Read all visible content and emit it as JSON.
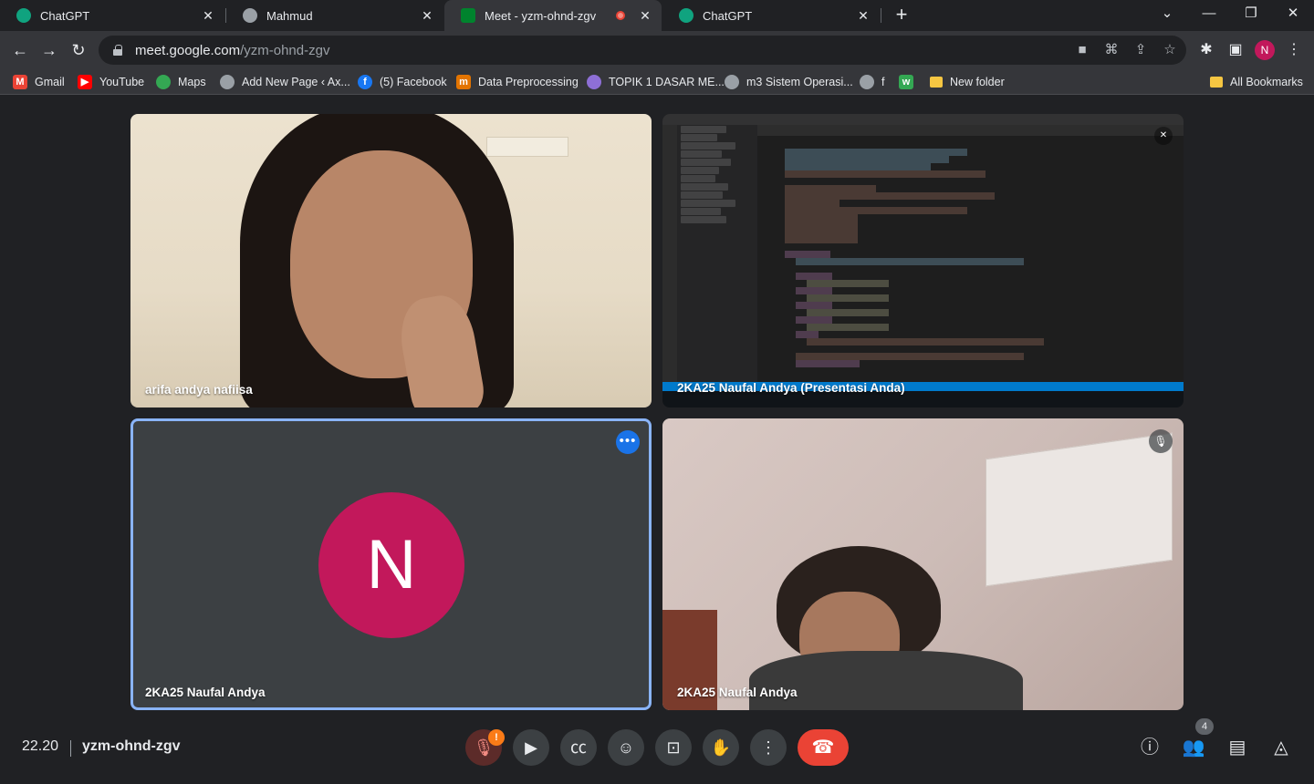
{
  "tabs": [
    {
      "title": "ChatGPT",
      "favicon": "chatgpt-icon",
      "color": "#10a37f"
    },
    {
      "title": "Mahmud",
      "favicon": "globe-icon",
      "color": "#9aa0a6"
    },
    {
      "title": "Meet - yzm-ohnd-zgv",
      "favicon": "meet-icon",
      "color": "#00832d",
      "active": true,
      "recording": true
    },
    {
      "title": "ChatGPT",
      "favicon": "chatgpt-icon",
      "color": "#10a37f"
    }
  ],
  "url": {
    "host": "meet.google.com",
    "path": "/yzm-ohnd-zgv"
  },
  "bookmarks": [
    {
      "label": "Gmail",
      "icon": "gmail-icon",
      "color": "#ea4335"
    },
    {
      "label": "YouTube",
      "icon": "youtube-icon",
      "color": "#ff0000"
    },
    {
      "label": "Maps",
      "icon": "maps-icon",
      "color": "#34a853"
    },
    {
      "label": "Add New Page ‹ Ax...",
      "icon": "globe-icon",
      "color": "#9aa0a6"
    },
    {
      "label": "(5) Facebook",
      "icon": "facebook-icon",
      "color": "#1877f2"
    },
    {
      "label": "Data Preprocessing",
      "icon": "medium-icon",
      "color": "#e37400"
    },
    {
      "label": "TOPIK 1 DASAR ME...",
      "icon": "campus-icon",
      "color": "#8e6fd6"
    },
    {
      "label": "m3 Sistem Operasi...",
      "icon": "globe-icon",
      "color": "#9aa0a6"
    },
    {
      "label": "f",
      "icon": "globe-icon",
      "color": "#9aa0a6"
    },
    {
      "label": "",
      "icon": "w-icon",
      "color": "#34a853"
    },
    {
      "label": "New folder",
      "icon": "folder-icon",
      "color": "#f6c642"
    }
  ],
  "all_bookmarks": "All Bookmarks",
  "profile_initial": "N",
  "tiles": {
    "cam1_name": "arifa andya nafiisa",
    "share_name": "2KA25 Naufal Andya (Presentasi Anda)",
    "avatar_name": "2KA25 Naufal Andya",
    "avatar_initial": "N",
    "cam2_name": "2KA25 Naufal Andya"
  },
  "meeting": {
    "time": "22.20",
    "code": "yzm-ohnd-zgv",
    "participants_count": "4"
  },
  "colors": {
    "accent": "#8ab4f8",
    "avatar": "#c2185b",
    "hangup": "#ea4335",
    "muted_bg": "#5c2b29"
  }
}
